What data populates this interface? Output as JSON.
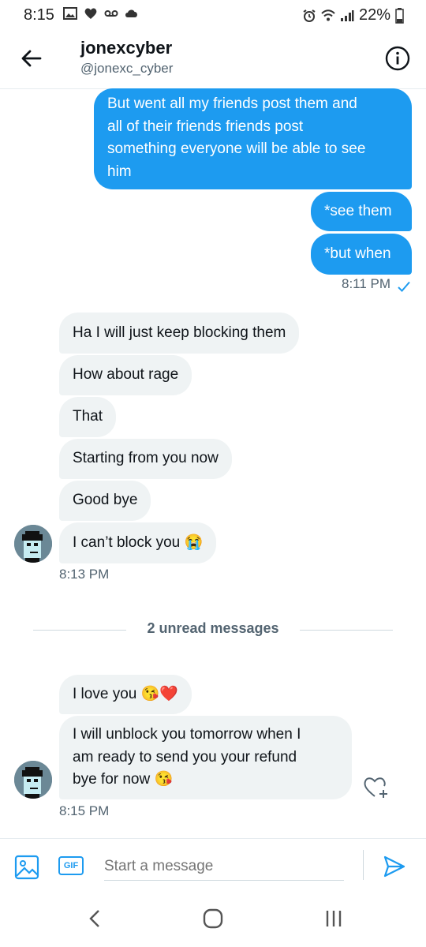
{
  "status_bar": {
    "time": "8:15",
    "battery": "22%"
  },
  "header": {
    "name": "jonexcyber",
    "handle": "@jonexc_cyber"
  },
  "sent_messages": [
    {
      "lines": [
        "But went all my friends post them and",
        "all of their friends friends post",
        "something everyone will be able to see",
        "him"
      ]
    },
    {
      "lines": [
        "*see them"
      ]
    },
    {
      "lines": [
        "*but when"
      ]
    }
  ],
  "sent_timestamp": "8:11 PM",
  "received_group_1": [
    "Ha I will just keep blocking them",
    "How about rage",
    "That",
    "Starting from you now",
    "Good bye",
    "I can’t block you 😭"
  ],
  "received_timestamp_1": "8:13 PM",
  "unread_divider": "2 unread messages",
  "received_group_2": [
    {
      "lines": [
        "I love you 😘❤️"
      ]
    },
    {
      "lines": [
        "I will unblock you tomorrow when I",
        "am ready to send you your refund",
        "bye for now 😘"
      ]
    }
  ],
  "received_timestamp_2": "8:15 PM",
  "composer": {
    "placeholder": "Start a message",
    "gif_label": "GIF"
  },
  "colors": {
    "accent": "#1d9bf0",
    "received_bubble": "#eff3f4",
    "muted_text": "#536471"
  }
}
